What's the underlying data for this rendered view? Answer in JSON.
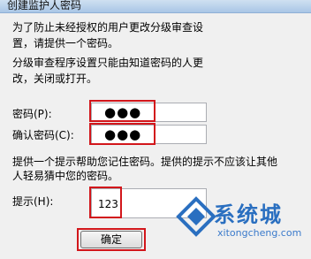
{
  "window": {
    "title": "创建监护人密码"
  },
  "intro": {
    "line1": "为了防止未经授权的用户更改分级审查设",
    "line2": "置，请提供一个密码。",
    "line3": "分级审查程序设置只能由知道密码的人更",
    "line4": "改，关闭或打开。"
  },
  "password": {
    "label": "密码(P):",
    "value": "●●●"
  },
  "confirm": {
    "label": "确认密码(C):",
    "value": "●●●"
  },
  "hint_text": {
    "line1": "提供一个提示帮助您记住密码。提供的提示不应该让其他",
    "line2": "人轻易猜中您的密码。"
  },
  "hint": {
    "label": "提示(H):",
    "value": "123"
  },
  "ok_button": {
    "label": "确定"
  },
  "watermark": {
    "brand": "系统城",
    "url": "xitongcheng.com"
  },
  "colors": {
    "highlight": "#d2161b",
    "accent": "#2a6fc0"
  }
}
